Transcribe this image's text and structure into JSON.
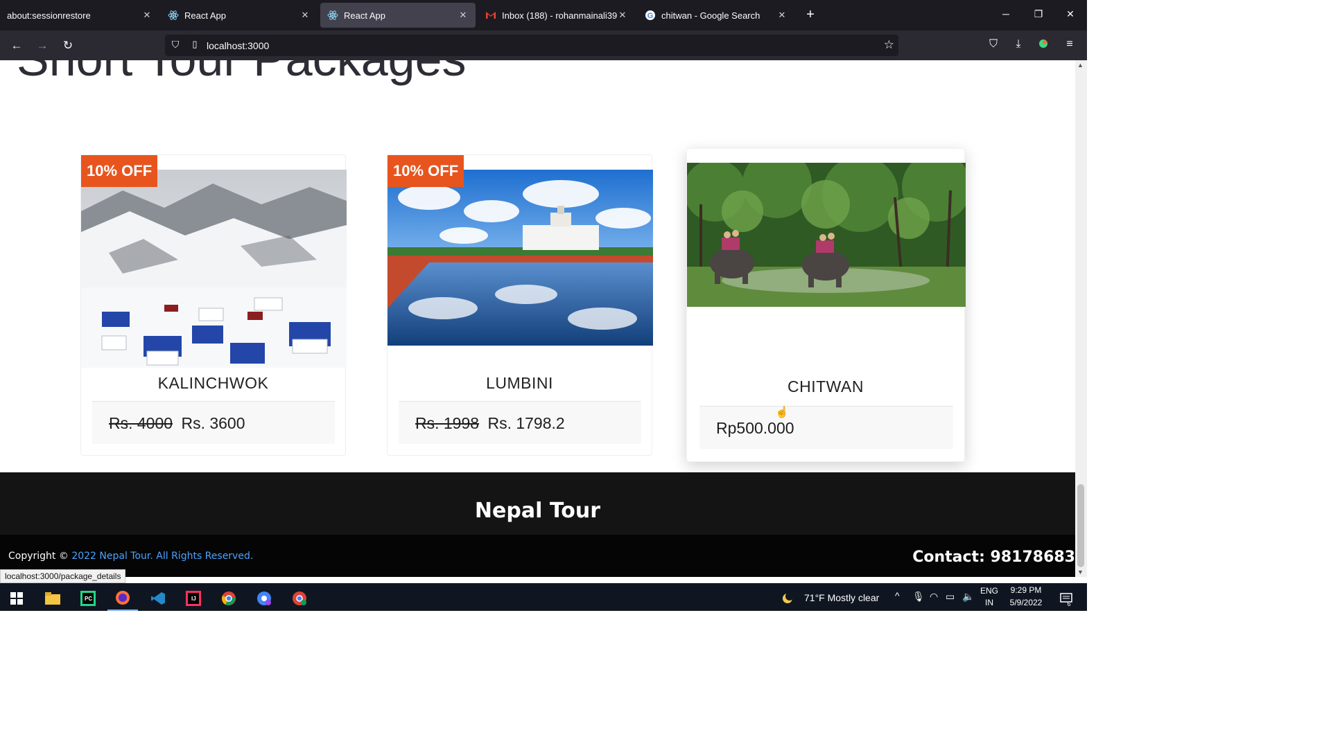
{
  "browser": {
    "tabs": [
      {
        "label": "about:sessionrestore",
        "icon": "blank-page-icon"
      },
      {
        "label": "React App",
        "icon": "react-icon"
      },
      {
        "label": "React App",
        "icon": "react-icon",
        "active": true
      },
      {
        "label": "Inbox (188) - rohanmainali39@",
        "icon": "gmail-icon"
      },
      {
        "label": "chitwan - Google Search",
        "icon": "google-icon"
      }
    ],
    "close_glyph": "✕",
    "new_tab_glyph": "+",
    "url": "localhost:3000"
  },
  "page": {
    "section_title": "Short Tour Packages",
    "packages": [
      {
        "name": "KALINCHWOK",
        "badge": "10% OFF",
        "old_price": "Rs. 4000",
        "price": "Rs. 3600"
      },
      {
        "name": "LUMBINI",
        "badge": "10% OFF",
        "old_price": "Rs. 1998",
        "price": "Rs. 1798.2"
      },
      {
        "name": "CHITWAN",
        "price": "Rp500.000"
      }
    ]
  },
  "footer": {
    "brand": "Nepal Tour",
    "copyright_prefix": "Copyright ©",
    "copyright_link": "2022 Nepal Tour. All Rights Reserved.",
    "contact": "Contact: 98178683"
  },
  "status_link": "localhost:3000/package_details",
  "taskbar": {
    "weather": "71°F  Mostly clear",
    "lang_top": "ENG",
    "lang_bottom": "IN",
    "time": "9:29 PM",
    "date": "5/9/2022",
    "notification_count": "6"
  },
  "colors": {
    "badge": "#e8541d",
    "link": "#4aa3ff",
    "footer_dark": "#141414"
  }
}
